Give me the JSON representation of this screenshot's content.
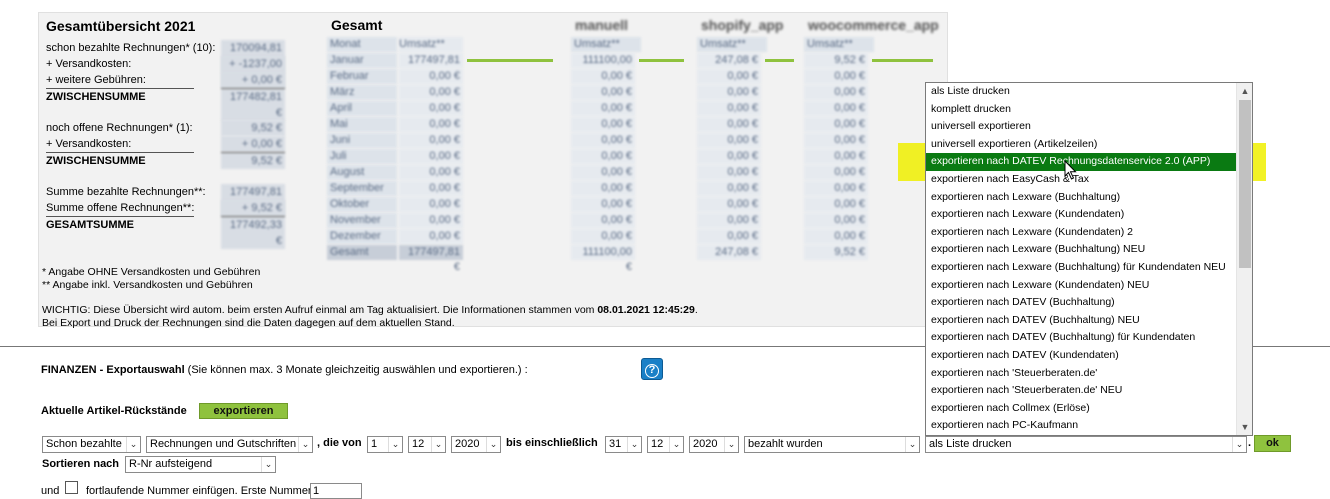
{
  "overview": {
    "left": {
      "title": "Gesamtübersicht 2021",
      "rows": [
        {
          "label": "schon bezahlte Rechnungen* (10):",
          "value": "170094,81 €",
          "bold": false
        },
        {
          "label": "+ Versandkosten:",
          "value": "+ -1237,00 €",
          "bold": false
        },
        {
          "label": "+ weitere Gebühren:",
          "value": "+ 0,00 €",
          "bold": false
        },
        {
          "label": "ZWISCHENSUMME",
          "value": "177482,81 €",
          "bold": true
        },
        {
          "label": "",
          "value": "",
          "gap": true
        },
        {
          "label": "noch offene Rechnungen* (1):",
          "value": "9,52 €",
          "bold": false
        },
        {
          "label": "+ Versandkosten:",
          "value": "+ 0,00 €",
          "bold": false
        },
        {
          "label": "ZWISCHENSUMME",
          "value": "9,52 €",
          "bold": true
        },
        {
          "label": "",
          "value": "",
          "gap": true
        },
        {
          "label": "Summe bezahlte Rechnungen**:",
          "value": "177497,81 €",
          "bold": false
        },
        {
          "label": "Summe offene Rechnungen**:",
          "value": "+ 9,52 €",
          "bold": false
        },
        {
          "label": "GESAMTSUMME",
          "value": "177492,33 €",
          "bold": true
        }
      ]
    },
    "groups": [
      {
        "title": "Gesamt",
        "blurred": false,
        "head": [
          "Monat",
          "Umsatz**"
        ],
        "rows": [
          {
            "m": "Januar",
            "v": "177497,81 €",
            "bar": 0.9
          },
          {
            "m": "Februar",
            "v": "0,00 €",
            "bar": 0
          },
          {
            "m": "März",
            "v": "0,00 €",
            "bar": 0
          },
          {
            "m": "April",
            "v": "0,00 €",
            "bar": 0
          },
          {
            "m": "Mai",
            "v": "0,00 €",
            "bar": 0
          },
          {
            "m": "Juni",
            "v": "0,00 €",
            "bar": 0
          },
          {
            "m": "Juli",
            "v": "0,00 €",
            "bar": 0
          },
          {
            "m": "August",
            "v": "0,00 €",
            "bar": 0
          },
          {
            "m": "September",
            "v": "0,00 €",
            "bar": 0
          },
          {
            "m": "Oktober",
            "v": "0,00 €",
            "bar": 0
          },
          {
            "m": "November",
            "v": "0,00 €",
            "bar": 0
          },
          {
            "m": "Dezember",
            "v": "0,00 €",
            "bar": 0
          },
          {
            "m": "Gesamt",
            "v": "177497,81 €",
            "bar": 0,
            "sum": true
          }
        ]
      },
      {
        "title": "manuell",
        "blurred": true,
        "head": [
          "Umsatz**",
          ""
        ],
        "rows": [
          {
            "m": "111100,00 €",
            "v": "",
            "bar": 0.9
          },
          {
            "m": "0,00 €",
            "v": "",
            "bar": 0
          },
          {
            "m": "0,00 €",
            "v": "",
            "bar": 0
          },
          {
            "m": "0,00 €",
            "v": "",
            "bar": 0
          },
          {
            "m": "0,00 €",
            "v": "",
            "bar": 0
          },
          {
            "m": "0,00 €",
            "v": "",
            "bar": 0
          },
          {
            "m": "0,00 €",
            "v": "",
            "bar": 0
          },
          {
            "m": "0,00 €",
            "v": "",
            "bar": 0
          },
          {
            "m": "0,00 €",
            "v": "",
            "bar": 0
          },
          {
            "m": "0,00 €",
            "v": "",
            "bar": 0
          },
          {
            "m": "0,00 €",
            "v": "",
            "bar": 0
          },
          {
            "m": "0,00 €",
            "v": "",
            "bar": 0
          },
          {
            "m": "111100,00 €",
            "v": "",
            "bar": 0,
            "sum": true
          }
        ]
      },
      {
        "title": "shopify_app",
        "blurred": true,
        "head": [
          "Umsatz**",
          ""
        ],
        "rows": [
          {
            "m": "247,08 €",
            "v": "",
            "bar": 0.9
          },
          {
            "m": "0,00 €",
            "v": "",
            "bar": 0
          },
          {
            "m": "0,00 €",
            "v": "",
            "bar": 0
          },
          {
            "m": "0,00 €",
            "v": "",
            "bar": 0
          },
          {
            "m": "0,00 €",
            "v": "",
            "bar": 0
          },
          {
            "m": "0,00 €",
            "v": "",
            "bar": 0
          },
          {
            "m": "0,00 €",
            "v": "",
            "bar": 0
          },
          {
            "m": "0,00 €",
            "v": "",
            "bar": 0
          },
          {
            "m": "0,00 €",
            "v": "",
            "bar": 0
          },
          {
            "m": "0,00 €",
            "v": "",
            "bar": 0
          },
          {
            "m": "0,00 €",
            "v": "",
            "bar": 0
          },
          {
            "m": "0,00 €",
            "v": "",
            "bar": 0
          },
          {
            "m": "247,08 €",
            "v": "",
            "bar": 0,
            "sum": true
          }
        ]
      },
      {
        "title": "woocommerce_app",
        "blurred": true,
        "head": [
          "Umsatz**",
          ""
        ],
        "rows": [
          {
            "m": "9,52 €",
            "v": "",
            "bar": 0.9
          },
          {
            "m": "0,00 €",
            "v": "",
            "bar": 0
          },
          {
            "m": "0,00 €",
            "v": "",
            "bar": 0
          },
          {
            "m": "0,00 €",
            "v": "",
            "bar": 0
          },
          {
            "m": "0,00 €",
            "v": "",
            "bar": 0
          },
          {
            "m": "0,00 €",
            "v": "",
            "bar": 0
          },
          {
            "m": "0,00 €",
            "v": "",
            "bar": 0
          },
          {
            "m": "0,00 €",
            "v": "",
            "bar": 0
          },
          {
            "m": "0,00 €",
            "v": "",
            "bar": 0
          },
          {
            "m": "0,00 €",
            "v": "",
            "bar": 0
          },
          {
            "m": "0,00 €",
            "v": "",
            "bar": 0
          },
          {
            "m": "0,00 €",
            "v": "",
            "bar": 0
          },
          {
            "m": "9,52 €",
            "v": "",
            "bar": 0,
            "sum": true
          }
        ]
      }
    ],
    "footnote1": "* Angabe OHNE Versandkosten und Gebühren",
    "footnote2": "** Angabe inkl. Versandkosten und Gebühren",
    "notice_part1": "WICHTIG: Diese Übersicht wird autom. beim ersten Aufruf einmal am Tag aktualisiert. Die Informationen stammen vom ",
    "notice_date": "08.01.2021 12:45:29",
    "notice_part2": ".",
    "notice_line2": "Bei Export und Druck der Rechnungen sind die Daten dagegen auf dem aktuellen Stand."
  },
  "finance": {
    "title": "FINANZEN - Exportauswahl",
    "subtitle": " (Sie können max. 3 Monate gleichzeitig auswählen und exportieren.) :",
    "help": "?",
    "backlog_label": "Aktuelle Artikel-Rückstände",
    "backlog_button": "exportieren",
    "status_select": "Schon bezahlte",
    "type_select": "Rechnungen und Gutschriften",
    "die_von": ", die von",
    "from_day": "1",
    "from_month": "12",
    "from_year": "2020",
    "until_label": "bis einschließlich",
    "to_day": "31",
    "to_month": "12",
    "to_year": "2020",
    "condition_select": "bezahlt wurden",
    "action_select": "als Liste drucken",
    "dot": ".",
    "ok_button": "ok",
    "sort_label": "Sortieren nach",
    "sort_select": "R-Nr aufsteigend",
    "und": "und",
    "consecutive_label": "fortlaufende Nummer einfügen. Erste Nummer:",
    "first_number": "1"
  },
  "dropdown": {
    "selected_index": 4,
    "options": [
      "als Liste drucken",
      "komplett drucken",
      "universell exportieren",
      "universell exportieren (Artikelzeilen)",
      "exportieren nach DATEV Rechnungsdatenservice 2.0 (APP)",
      "exportieren nach EasyCash & Tax",
      "exportieren nach Lexware (Buchhaltung)",
      "exportieren nach Lexware (Kundendaten)",
      "exportieren nach Lexware (Kundendaten) 2",
      "exportieren nach Lexware (Buchhaltung) NEU",
      "exportieren nach Lexware (Buchhaltung) für Kundendaten NEU",
      "exportieren nach Lexware (Kundendaten) NEU",
      "exportieren nach DATEV (Buchhaltung)",
      "exportieren nach DATEV (Buchhaltung) NEU",
      "exportieren nach DATEV (Buchhaltung) für Kundendaten",
      "exportieren nach DATEV (Kundendaten)",
      "exportieren nach 'Steuerberaten.de'",
      "exportieren nach 'Steuerberaten.de' NEU",
      "exportieren nach Collmex (Erlöse)",
      "exportieren nach PC-Kaufmann"
    ]
  },
  "colors": {
    "accent_green": "#8fc23e",
    "selected_green": "#0a7a12",
    "highlight_yellow": "#f0f000",
    "help_blue": "#1a80c7"
  }
}
